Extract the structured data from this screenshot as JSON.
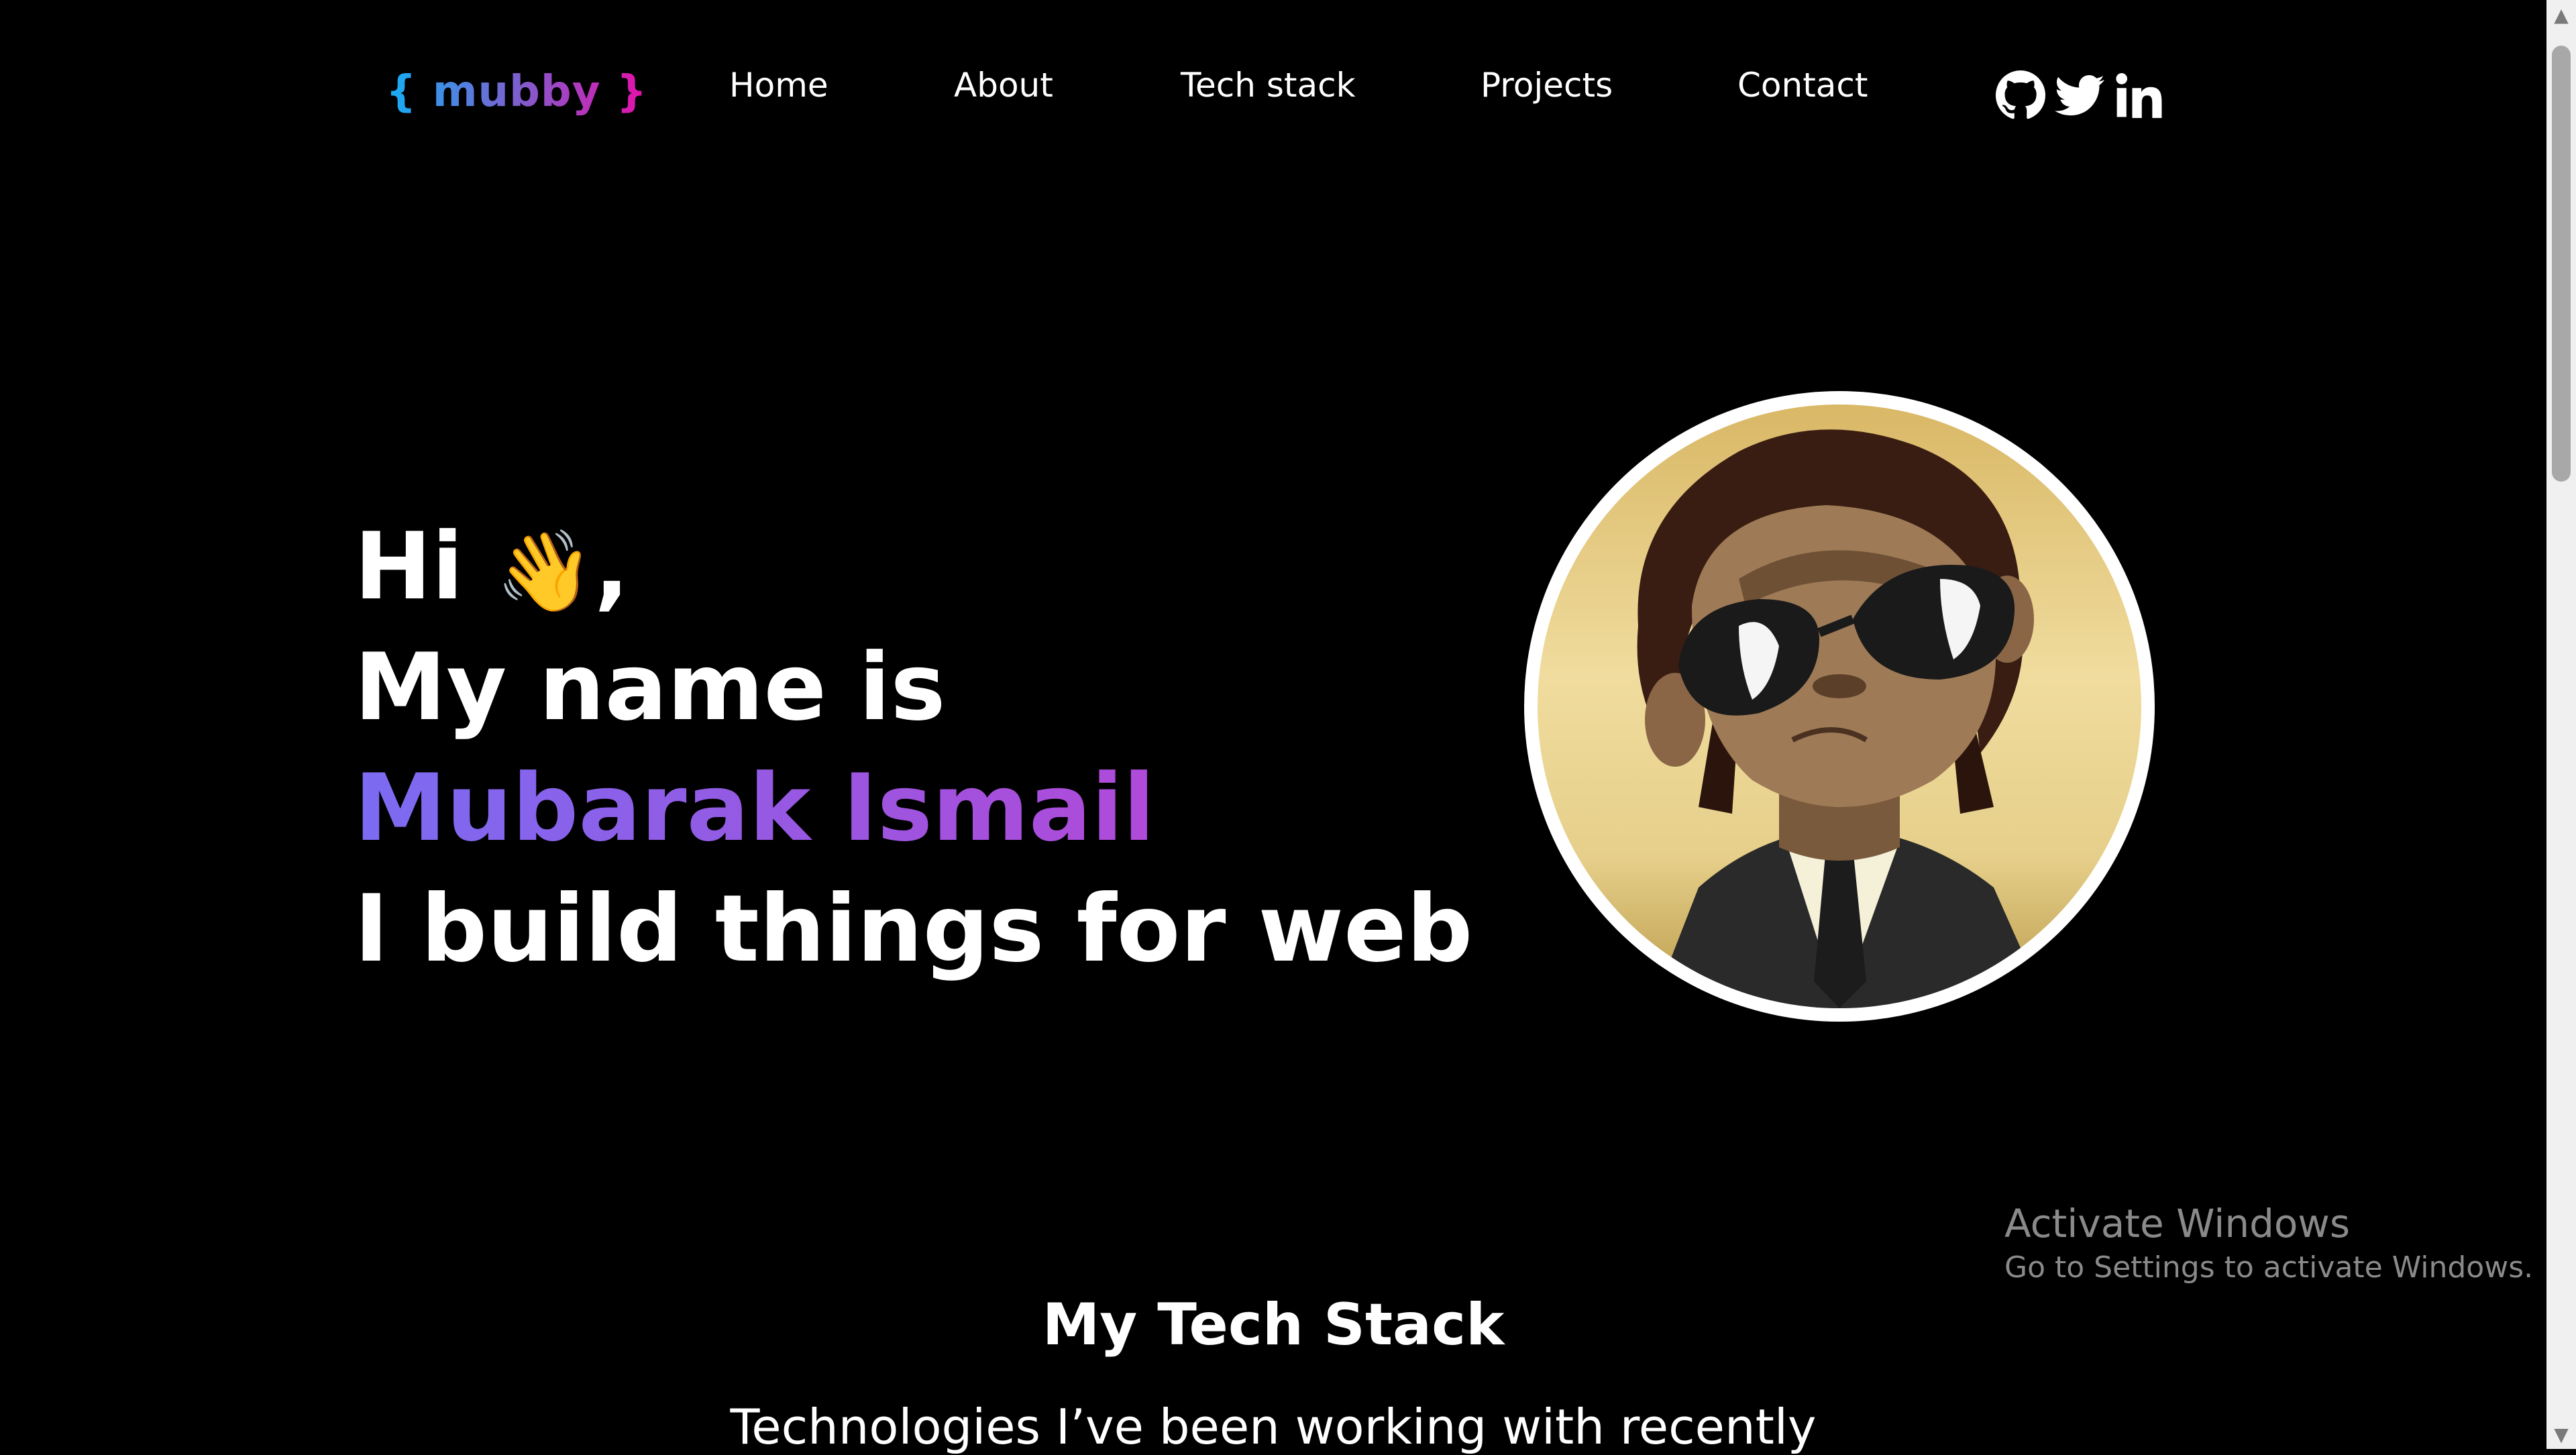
{
  "header": {
    "logo": "{ mubby }",
    "nav": [
      "Home",
      "About",
      "Tech stack",
      "Projects",
      "Contact"
    ],
    "socials": [
      "github-icon",
      "twitter-icon",
      "linkedin-icon"
    ]
  },
  "hero": {
    "greeting": "Hi",
    "wave_emoji": "👋",
    "greeting_punct": ",",
    "line2": "My name is",
    "name": "Mubarak Ismail",
    "line4": "I build things for web",
    "gradient": [
      "#13b0f5",
      "#e70faa"
    ]
  },
  "tech_stack": {
    "title": "My Tech Stack",
    "subtitle": "Technologies I’ve been working with recently"
  },
  "watermark": {
    "title": "Activate Windows",
    "subtitle": "Go to Settings to activate Windows."
  }
}
